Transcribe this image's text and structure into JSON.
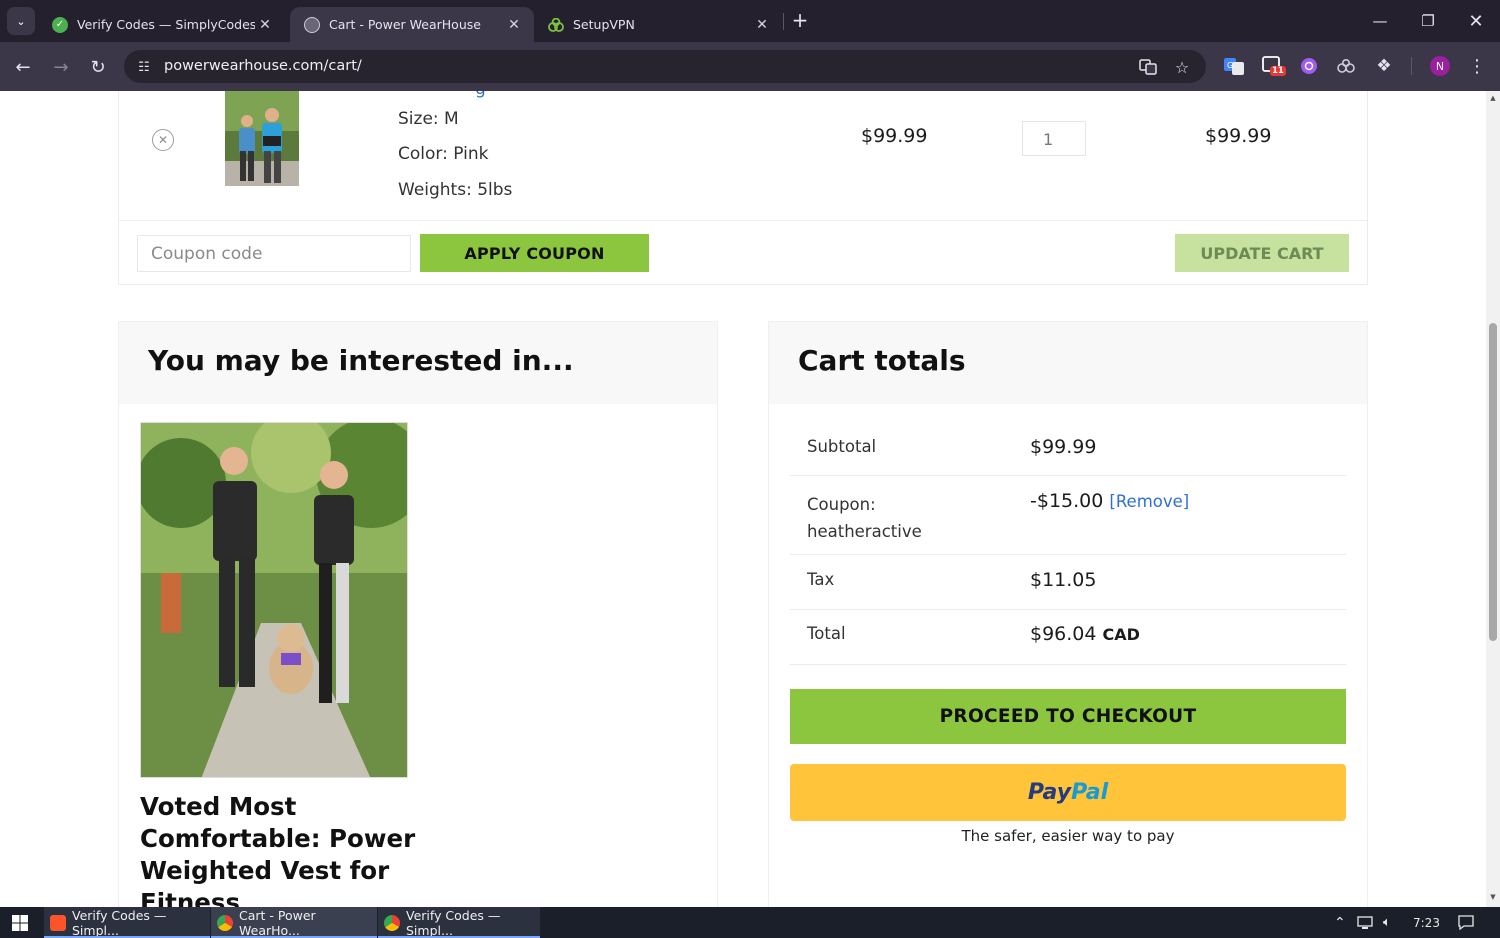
{
  "browser": {
    "tabs": [
      {
        "title": "Verify Codes — SimplyCodes",
        "active": false
      },
      {
        "title": "Cart - Power WearHouse",
        "active": true
      },
      {
        "title": "SetupVPN",
        "active": false
      }
    ],
    "url": "powerwearhouse.com/cart/",
    "profile_initial": "N",
    "extension_badge": "11"
  },
  "cart_item": {
    "size": "Size: M",
    "color": "Color: Pink",
    "weights": "Weights: 5lbs",
    "price": "$99.99",
    "quantity": "1",
    "subtotal": "$99.99"
  },
  "coupon": {
    "placeholder": "Coupon code",
    "apply_label": "APPLY COUPON",
    "update_label": "UPDATE CART"
  },
  "interested": {
    "title": "You may be interested in...",
    "product_title": "Voted Most Comfortable: Power Weighted Vest for Fitness"
  },
  "totals": {
    "title": "Cart totals",
    "subtotal_label": "Subtotal",
    "subtotal_value": "$99.99",
    "coupon_label": "Coupon: heatheractive",
    "coupon_value": "-$15.00",
    "coupon_remove": "[Remove]",
    "tax_label": "Tax",
    "tax_value": "$11.05",
    "total_label": "Total",
    "total_value": "$96.04",
    "total_currency": "CAD",
    "checkout_label": "PROCEED TO CHECKOUT",
    "paypal_pay": "Pay",
    "paypal_pal": "Pal",
    "paypal_tagline": "The safer, easier way to pay"
  },
  "colors": {
    "accent_green": "#8cc63e",
    "paypal_yellow": "#ffc439",
    "link_blue": "#2f6fd6"
  },
  "taskbar": {
    "items": [
      "Verify Codes — Simpl...",
      "Cart - Power WearHo...",
      "Verify Codes — Simpl..."
    ],
    "time": "7:23"
  }
}
